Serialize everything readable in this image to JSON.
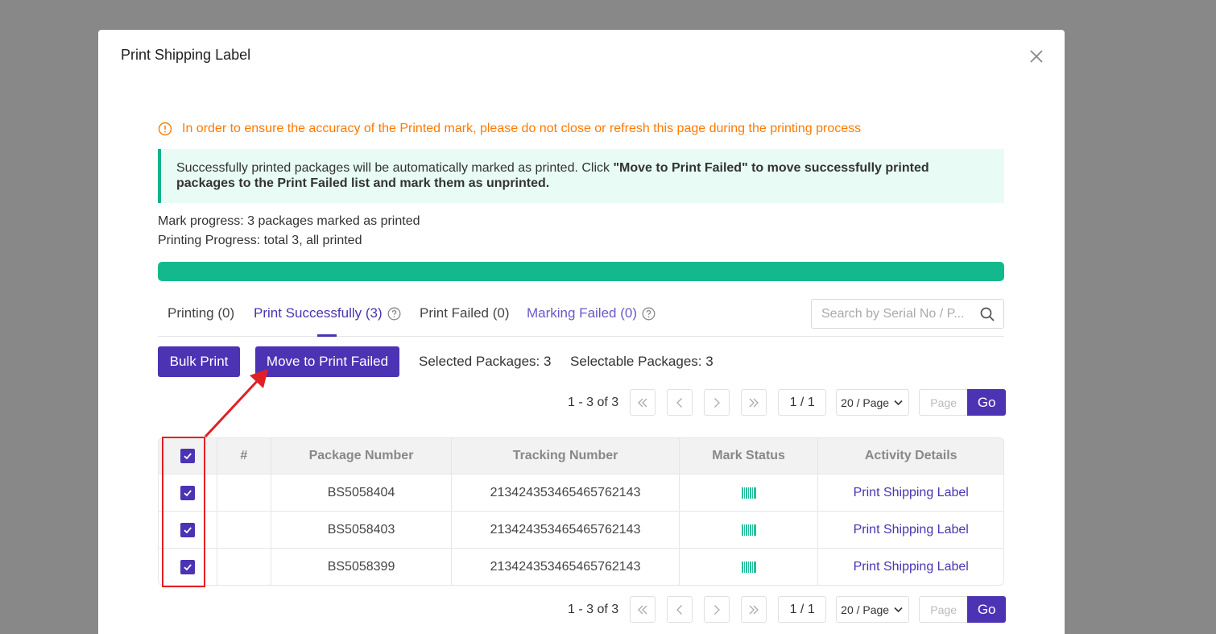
{
  "modal": {
    "title": "Print Shipping Label"
  },
  "warning": "In order to ensure the accuracy of the Printed mark, please do not close or refresh this page during the printing process",
  "notice": {
    "text_plain": "Successfully printed packages will be automatically marked as printed. Click ",
    "text_bold": "\"Move to Print Failed\" to move successfully printed packages to the Print Failed list and mark them as unprinted."
  },
  "progress": {
    "mark_text": "Mark progress: 3 packages marked as printed",
    "print_text": "Printing Progress: total 3, all printed",
    "percent": 100,
    "color": "#13b88c"
  },
  "tabs": [
    {
      "label": "Printing (0)"
    },
    {
      "label": "Print Successfully (3)"
    },
    {
      "label": "Print Failed (0)"
    },
    {
      "label": "Marking Failed (0)"
    }
  ],
  "search": {
    "placeholder": "Search by Serial No / P..."
  },
  "toolbar": {
    "bulk_print": "Bulk Print",
    "move_to_failed": "Move to Print Failed",
    "selected": "Selected Packages: 3",
    "selectable": "Selectable Packages: 3"
  },
  "pagination": {
    "range": "1 - 3 of 3",
    "page_info": "1 / 1",
    "page_size": "20 / Page",
    "page_placeholder": "Page",
    "go": "Go"
  },
  "table": {
    "headers": [
      "#",
      "Package Number",
      "Tracking Number",
      "Mark Status",
      "Activity Details"
    ],
    "rows": [
      {
        "package": "BS5058404",
        "tracking": "213424353465465762143",
        "activity": "Print Shipping Label"
      },
      {
        "package": "BS5058403",
        "tracking": "213424353465465762143",
        "activity": "Print Shipping Label"
      },
      {
        "package": "BS5058399",
        "tracking": "213424353465465762143",
        "activity": "Print Shipping Label"
      }
    ]
  },
  "colors": {
    "accent": "#4b33b3",
    "warning": "#ff7a00",
    "success": "#13b88c",
    "annotation": "#e31f26"
  }
}
